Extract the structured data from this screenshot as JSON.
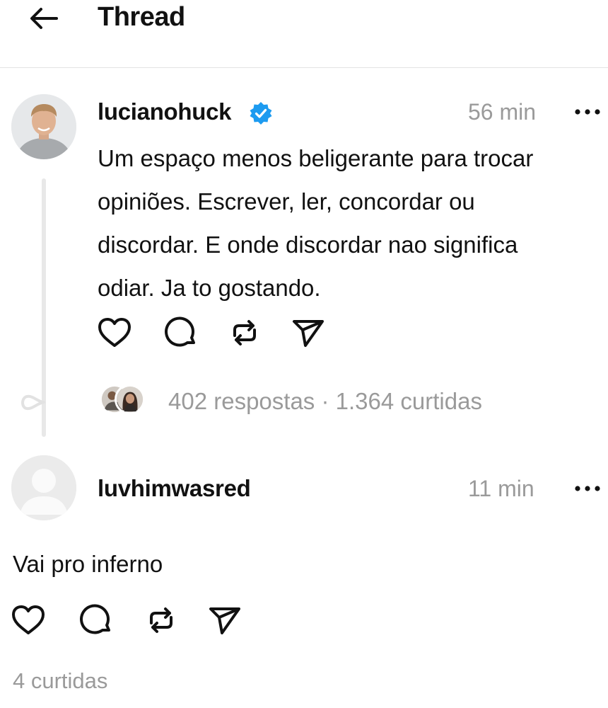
{
  "header": {
    "title": "Thread",
    "back_icon": "arrow-left-icon"
  },
  "post": {
    "username": "lucianohuck",
    "verified": true,
    "time": "56 min",
    "lines": [
      "Um espaço menos beligerante para trocar",
      "opiniões. Escrever, ler, concordar ou",
      "discordar. E onde discordar nao significa",
      "odiar. Ja to gostando."
    ],
    "replies": "402 respostas",
    "separator": "·",
    "likes": "1.364 curtidas"
  },
  "reply": {
    "username": "luvhimwasred",
    "time": "11 min",
    "text": "Vai pro inferno",
    "likes": "4 curtidas"
  },
  "icons": {
    "like": "heart-icon",
    "comment": "comment-icon",
    "repost": "repost-icon",
    "share": "send-icon",
    "more": "more-dots-icon",
    "verified": "verified-badge-icon",
    "thread_loop": "thread-loop-icon"
  },
  "colors": {
    "verified": "#1d9bf0",
    "muted": "#9a9a9a",
    "text": "#111111",
    "divider": "#e4e4e4"
  }
}
